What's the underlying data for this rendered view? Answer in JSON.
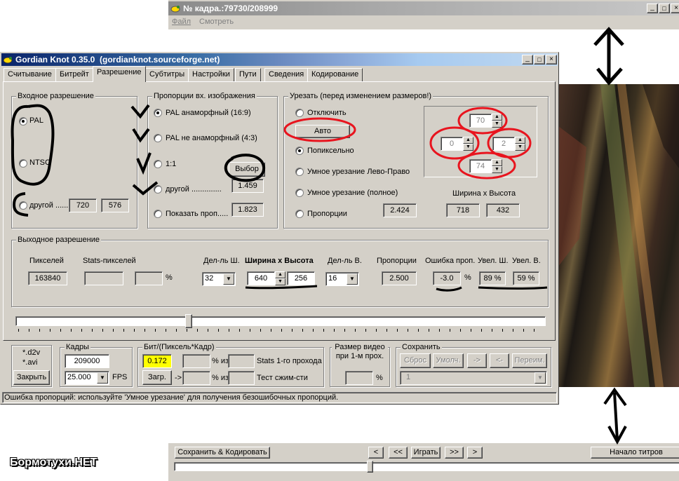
{
  "viewer": {
    "title": "№ кадра.:79730/208999",
    "menu": [
      "Файл",
      "Смотреть"
    ],
    "buttons": {
      "save_encode": "Сохранить & Кодировать",
      "prev": "<",
      "prev_fast": "<<",
      "play": "Играть",
      "next_fast": ">>",
      "next": ">",
      "credits": "Начало титров"
    }
  },
  "gk": {
    "title": "Gordian Knot 0.35.0  (gordianknot.sourceforge.net)",
    "tabs": [
      "Считывание",
      "Битрейт",
      "Разрешение",
      "Субтитры",
      "Настройки",
      "Пути",
      "Сведения",
      "Кодирование"
    ],
    "input_res": {
      "title": "Входное разрешение",
      "pal": "PAL",
      "ntsc": "NTSC",
      "other": "другой ......",
      "width": "720",
      "height": "576"
    },
    "aspect": {
      "title": "Пропорции вх. изображения",
      "pal_anamorphic": "PAL анаморфный (16:9)",
      "pal_non": "PAL не анаморфный (4:3)",
      "one_one": "1:1",
      "choose": "Выбор",
      "other": "другой ..............",
      "other_value": "1.459",
      "show": "Показать проп.....",
      "show_value": "1.823"
    },
    "crop": {
      "title": "Урезать (перед изменением размеров!)",
      "off": "Отключить",
      "auto": "Авто",
      "pixel": "Попиксельно",
      "smart_lr": "Умное урезание Лево-Право",
      "smart_full": "Умное урезание (полное)",
      "aspect": "Пропорции",
      "aspect_value": "2.424",
      "top": "70",
      "left": "0",
      "right": "2",
      "bottom": "74",
      "wh_label": "Ширина х Высота",
      "width": "718",
      "height": "432"
    },
    "output": {
      "title": "Выходное разрешение",
      "pixels_label": "Пикселей",
      "pixels": "163840",
      "stats_label": "Stats-пикселей",
      "pct": "%",
      "div_w_label": "Дел-ль Ш.",
      "div_w": "32",
      "wh_label": "Ширина х Высота",
      "width": "640",
      "height": "256",
      "div_h_label": "Дел-ль В.",
      "div_h": "16",
      "aspect_label": "Пропорции",
      "aspect": "2.500",
      "err_label": "Ошибка проп.",
      "err": "-3.0",
      "err_pct": "%",
      "zoom_w_label": "Увел. Ш.",
      "zoom_w": "89 %",
      "zoom_h_label": "Увел. В.",
      "zoom_h": "59 %"
    },
    "slider_value": 0.325,
    "bottom": {
      "d2v": "*.d2v",
      "avi": "*.avi",
      "close": "Закрыть",
      "frames_title": "Кадры",
      "frames": "209000",
      "fps": "25.000",
      "fps_label": "FPS",
      "bpp_title": "Бит/(Пиксель*Кадр)",
      "bpp": "0.172",
      "pct_of": "% из",
      "stats1": "Stats 1-го прохода",
      "load": "Загр.",
      "arrow": "->",
      "test": "Тест сжим-сти",
      "size_title": "Размер видео при 1-м прох.",
      "size_pct": "%",
      "save_title": "Сохранить",
      "reset": "Сброс",
      "default": "Умолч.",
      "right": "->",
      "left": "<-",
      "rename": "Переим.",
      "slot": "1"
    },
    "status": "Ошибка пропорций: используйте 'Умное урезание' для получения безошибочных пропорций."
  },
  "watermark": "Бормотухи.НЕТ",
  "colors": {
    "titlebar_gradient": [
      "#0a246a",
      "#a6caf0"
    ],
    "bpp_highlight": "#ffff00",
    "annotation_red": "#e8141e",
    "annotation_black": "#000000"
  }
}
